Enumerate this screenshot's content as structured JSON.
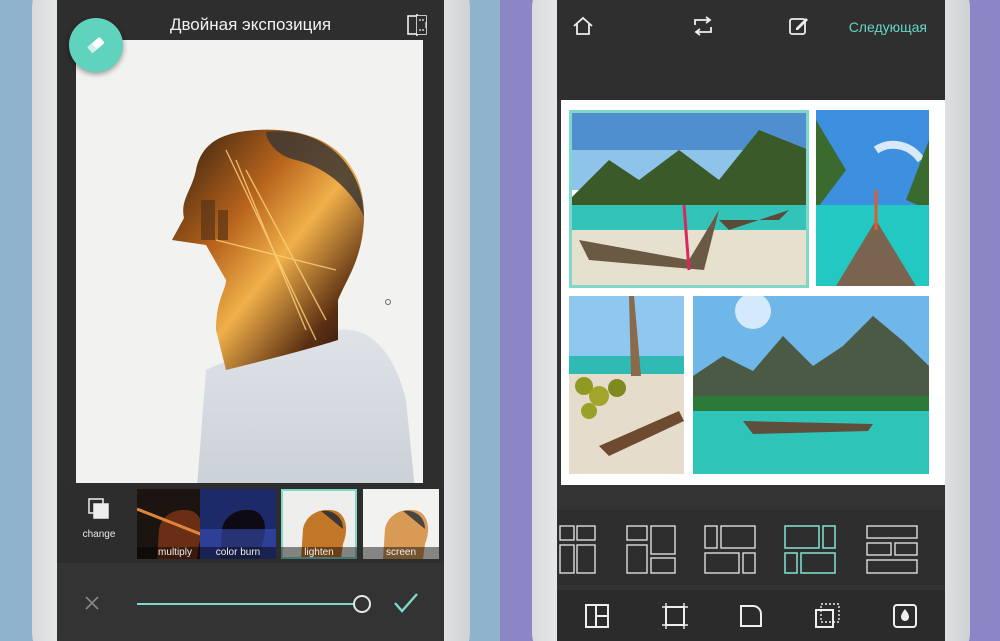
{
  "left_screen": {
    "title": "Двойная экспозиция",
    "change_label": "change",
    "blend_modes": [
      {
        "label": "multiply",
        "active": false
      },
      {
        "label": "color burn",
        "active": false
      },
      {
        "label": "lighten",
        "active": true
      },
      {
        "label": "screen",
        "active": false
      }
    ],
    "slider": {
      "value": 1.0
    },
    "accent_color": "#5fd3bd"
  },
  "right_screen": {
    "next_label": "Следующая",
    "accent_color": "#66d6c4",
    "layouts": [
      "layout-1",
      "layout-2",
      "layout-3",
      "layout-4",
      "layout-5"
    ],
    "selected_layout": 3,
    "tools": [
      "layout-tool-icon",
      "border-tool-icon",
      "corner-tool-icon",
      "shadow-tool-icon",
      "color-drop-icon"
    ]
  }
}
